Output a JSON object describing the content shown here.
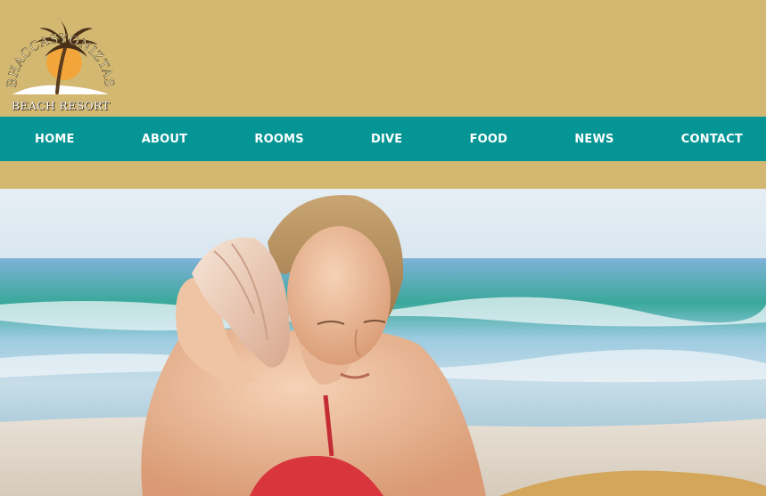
{
  "header": {
    "logo": {
      "arc_text": "BHACCASYONIZTAS",
      "subtitle": "BEACH RESORT"
    }
  },
  "nav": {
    "items": [
      {
        "label": "HOME"
      },
      {
        "label": "ABOUT"
      },
      {
        "label": "ROOMS"
      },
      {
        "label": "DIVE"
      },
      {
        "label": "FOOD"
      },
      {
        "label": "NEWS"
      },
      {
        "label": "CONTACT"
      }
    ]
  },
  "colors": {
    "background": "#d3b872",
    "nav_background": "#059595",
    "nav_text": "#ffffff"
  },
  "hero": {
    "image": "woman-holding-seashell-to-ear-on-beach"
  }
}
